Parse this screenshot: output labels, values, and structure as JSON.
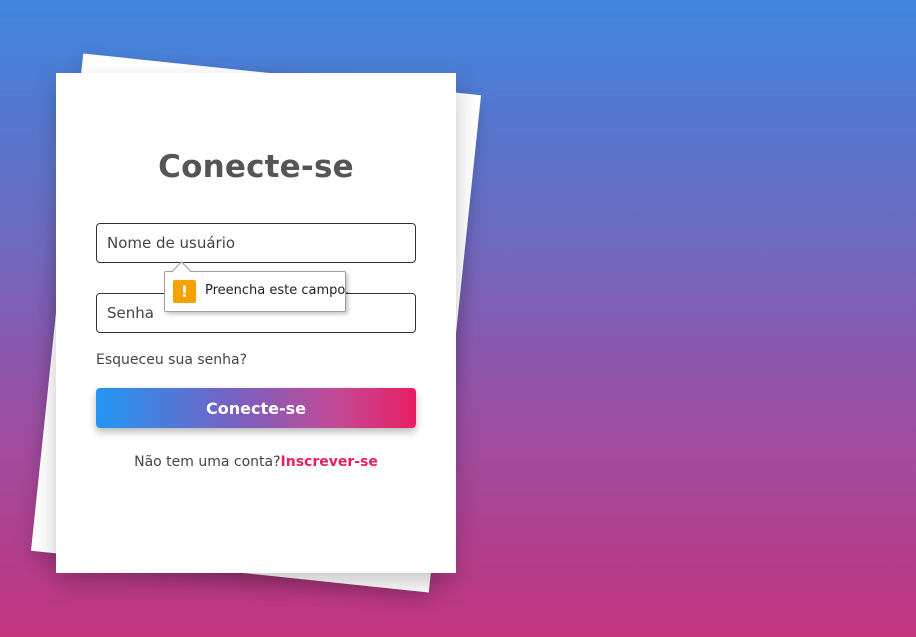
{
  "login": {
    "title": "Conecte-se",
    "username_placeholder": "Nome de usuário",
    "password_placeholder": "Senha",
    "forgot_password": "Esqueceu sua senha?",
    "submit_label": "Conecte-se",
    "no_account_text": "Não tem uma conta?",
    "signup_link": "Inscrever-se"
  },
  "validation": {
    "message": "Preencha este campo.",
    "icon": "warning-icon",
    "icon_glyph": "!"
  },
  "colors": {
    "button_gradient_start": "#2196f3",
    "button_gradient_end": "#e91e63",
    "signup_link": "#e91e63",
    "warning": "#f7a100"
  }
}
